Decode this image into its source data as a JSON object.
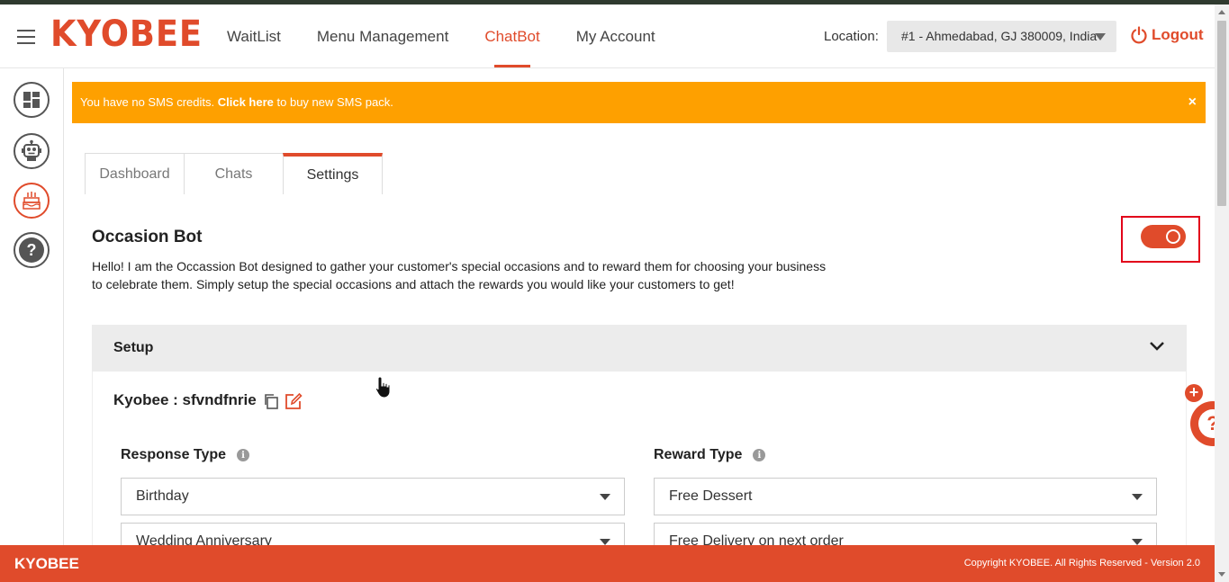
{
  "header": {
    "logo": "KYOBEE",
    "nav": [
      {
        "label": "WaitList"
      },
      {
        "label": "Menu Management"
      },
      {
        "label": "ChatBot",
        "active": true
      },
      {
        "label": "My Account"
      }
    ],
    "location_label": "Location:",
    "location_value": "#1 - Ahmedabad, GJ 380009, India",
    "logout_label": "Logout"
  },
  "sidebar": {
    "items": [
      {
        "icon": "dashboard-icon"
      },
      {
        "icon": "robot-icon"
      },
      {
        "icon": "cake-icon",
        "active": true
      },
      {
        "icon": "help-icon"
      }
    ]
  },
  "alert": {
    "text_before": "You have no SMS credits.",
    "link": "Click here",
    "text_after": "to buy new SMS pack.",
    "close": "×"
  },
  "tabs": [
    {
      "label": "Dashboard"
    },
    {
      "label": "Chats"
    },
    {
      "label": "Settings",
      "active": true
    }
  ],
  "bot": {
    "title": "Occasion Bot",
    "description": "Hello! I am the Occassion Bot designed to gather your customer's special occasions and to reward them for choosing your business to celebrate them. Simply setup the special occasions and attach the rewards you would like your customers to get!",
    "enabled": true
  },
  "setup": {
    "title": "Setup",
    "bot_id": "Kyobee : sfvndfnrie",
    "response_type_label": "Response Type",
    "reward_type_label": "Reward Type",
    "info_glyph": "i",
    "response_types": [
      "Birthday",
      "Wedding Anniversary"
    ],
    "reward_types": [
      "Free Dessert",
      "Free Delivery on next order"
    ]
  },
  "footer": {
    "brand": "KYOBEE",
    "copyright": "Copyright KYOBEE. All Rights Reserved - Version 2.0"
  },
  "widgets": {
    "plus": "+",
    "help": "?"
  },
  "colors": {
    "accent": "#e04b2b",
    "alert": "#fea000",
    "highlight_box": "#e2001a"
  }
}
